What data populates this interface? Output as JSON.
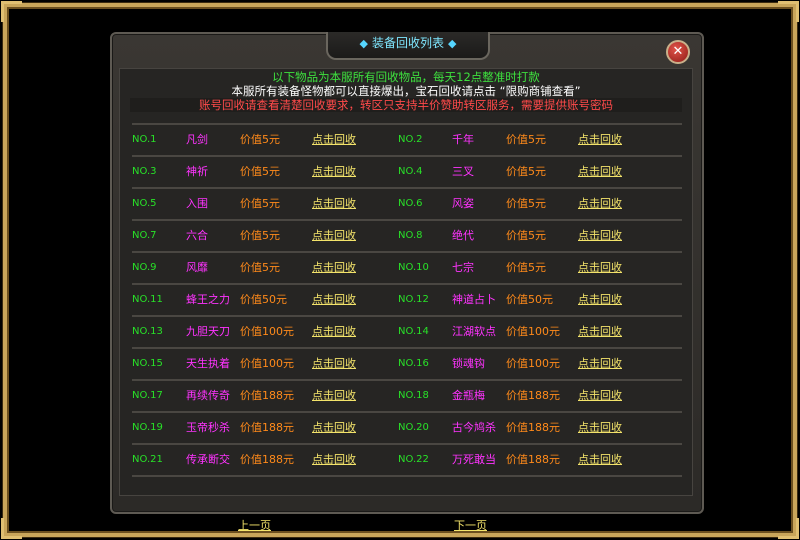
{
  "window": {
    "title": "装备回收列表",
    "close_glyph": "✕"
  },
  "notices": {
    "line1": "以下物品为本服所有回收物品，每天12点整准时打款",
    "line2": "本服所有装备怪物都可以直接爆出，宝石回收请点击 “限购商铺查看”",
    "line3": "账号回收请查看清楚回收要求，转区只支持半价赞助转区服务，需要提供账号密码"
  },
  "items": [
    {
      "no": "NO.1",
      "name": "凡剑",
      "value": "价值5元",
      "action": "点击回收"
    },
    {
      "no": "NO.2",
      "name": "千年",
      "value": "价值5元",
      "action": "点击回收"
    },
    {
      "no": "NO.3",
      "name": "神祈",
      "value": "价值5元",
      "action": "点击回收"
    },
    {
      "no": "NO.4",
      "name": "三叉",
      "value": "价值5元",
      "action": "点击回收"
    },
    {
      "no": "NO.5",
      "name": "入围",
      "value": "价值5元",
      "action": "点击回收"
    },
    {
      "no": "NO.6",
      "name": "风姿",
      "value": "价值5元",
      "action": "点击回收"
    },
    {
      "no": "NO.7",
      "name": "六合",
      "value": "价值5元",
      "action": "点击回收"
    },
    {
      "no": "NO.8",
      "name": "绝代",
      "value": "价值5元",
      "action": "点击回收"
    },
    {
      "no": "NO.9",
      "name": "风靡",
      "value": "价值5元",
      "action": "点击回收"
    },
    {
      "no": "NO.10",
      "name": "七宗",
      "value": "价值5元",
      "action": "点击回收"
    },
    {
      "no": "NO.11",
      "name": "蜂王之力",
      "value": "价值50元",
      "action": "点击回收"
    },
    {
      "no": "NO.12",
      "name": "神道占卜",
      "value": "价值50元",
      "action": "点击回收"
    },
    {
      "no": "NO.13",
      "name": "九胆天刀",
      "value": "价值100元",
      "action": "点击回收"
    },
    {
      "no": "NO.14",
      "name": "江湖软点",
      "value": "价值100元",
      "action": "点击回收"
    },
    {
      "no": "NO.15",
      "name": "天生执着",
      "value": "价值100元",
      "action": "点击回收"
    },
    {
      "no": "NO.16",
      "name": "锁魂钩",
      "value": "价值100元",
      "action": "点击回收"
    },
    {
      "no": "NO.17",
      "name": "再续传奇",
      "value": "价值188元",
      "action": "点击回收"
    },
    {
      "no": "NO.18",
      "name": "金瓶梅",
      "value": "价值188元",
      "action": "点击回收"
    },
    {
      "no": "NO.19",
      "name": "玉帝秒杀",
      "value": "价值188元",
      "action": "点击回收"
    },
    {
      "no": "NO.20",
      "name": "古今鸠杀",
      "value": "价值188元",
      "action": "点击回收"
    },
    {
      "no": "NO.21",
      "name": "传承断交",
      "value": "价值188元",
      "action": "点击回收"
    },
    {
      "no": "NO.22",
      "name": "万死敢当",
      "value": "价值188元",
      "action": "点击回收"
    }
  ],
  "pager": {
    "prev": "上一页",
    "next": "下一页"
  },
  "colors": {
    "number": "#28e128",
    "name": "#ff33ff",
    "value": "#ff8a1a",
    "action": "#f3e36a",
    "title": "#7fe7ff",
    "frame": "#c9a55a"
  }
}
